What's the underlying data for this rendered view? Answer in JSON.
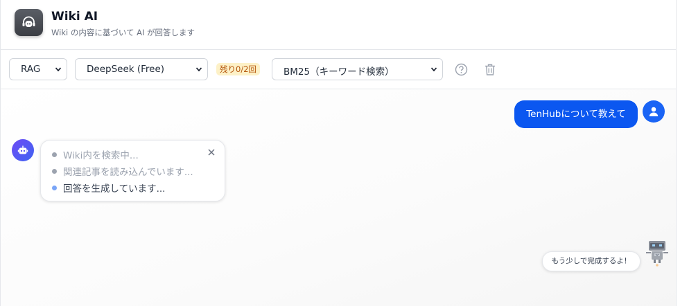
{
  "header": {
    "title": "Wiki AI",
    "subtitle": "Wiki の内容に基づいて AI が回答します",
    "logo_icon": "headset-robot-icon"
  },
  "toolbar": {
    "mode_select": {
      "value": "RAG",
      "options": [
        "RAG"
      ]
    },
    "model_select": {
      "value": "DeepSeek (Free)",
      "options": [
        "DeepSeek (Free)"
      ]
    },
    "remaining_badge": "残り0/2回",
    "search_select": {
      "value": "BM25（キーワード検索）",
      "options": [
        "BM25（キーワード検索）"
      ]
    },
    "help_icon": "question-circle-icon",
    "delete_icon": "trash-icon"
  },
  "chat": {
    "user_message": "TenHubについて教えて",
    "progress_steps": [
      {
        "label": "Wiki内を検索中...",
        "state": "done"
      },
      {
        "label": "関連記事を読み込んでいます...",
        "state": "done"
      },
      {
        "label": "回答を生成しています...",
        "state": "active"
      }
    ],
    "mascot_message": "もう少しで完成するよ！"
  },
  "colors": {
    "accent": "#0b57f0",
    "badge_bg": "#fdf1c7",
    "badge_text": "#b45309",
    "bot_avatar": "#5b55f3"
  }
}
